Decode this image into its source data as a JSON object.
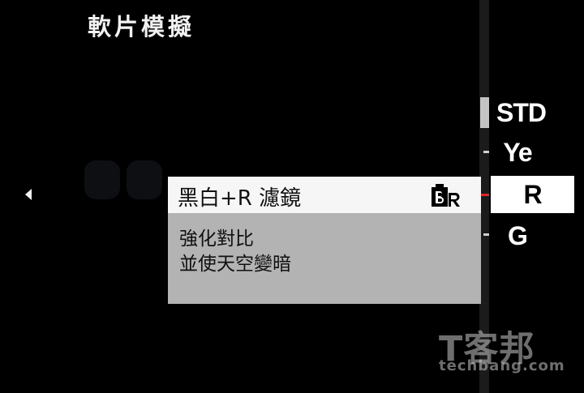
{
  "header": {
    "title": "軟片模擬"
  },
  "options": {
    "items": [
      {
        "label": "STD"
      },
      {
        "label": "Ye"
      },
      {
        "label": "R"
      },
      {
        "label": "G"
      }
    ],
    "selected": "R"
  },
  "popup": {
    "title": "黑白+R 濾鏡",
    "icon": "bw-red-filter-icon",
    "description": [
      "強化對比",
      "並使天空變暗"
    ]
  },
  "icons": {
    "left_nav": "left-arrow-icon",
    "popup_pointer": "pointer-arrow-icon"
  },
  "colors": {
    "selected_marker": "#e0242a",
    "popup_body": "#b3b3b3",
    "popup_header": "#f6f6f6",
    "background": "#000000"
  },
  "watermark": {
    "logo": "T客邦",
    "url": "techbang.com"
  }
}
